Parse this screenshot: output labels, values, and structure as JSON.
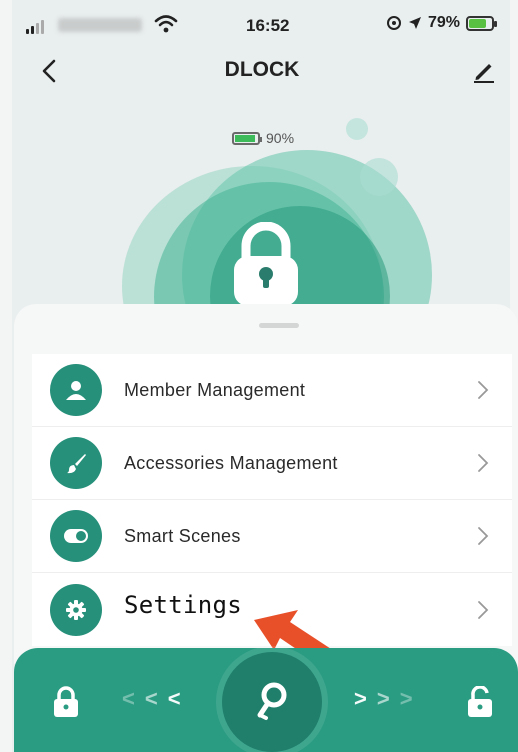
{
  "status_bar": {
    "time": "16:52",
    "battery_percent": "79%",
    "battery_level": 0.79
  },
  "header": {
    "title": "DLOCK",
    "back_icon": "chevron-left-icon",
    "edit_icon": "pencil-icon"
  },
  "lock": {
    "battery_percent": "90%",
    "battery_level": 0.9,
    "icon": "padlock-icon"
  },
  "menu": {
    "items": [
      {
        "label": "Member Management",
        "icon": "person-icon"
      },
      {
        "label": "Accessories Management",
        "icon": "brush-icon"
      },
      {
        "label": "Smart Scenes",
        "icon": "toggle-icon"
      },
      {
        "label": "Settings",
        "icon": "gear-icon"
      }
    ]
  },
  "bottom_bar": {
    "lock_icon": "lock-closed-icon",
    "unlock_icon": "lock-open-icon",
    "key_icon": "key-icon",
    "left_arrows": "< < <",
    "right_arrows": "> > >"
  },
  "colors": {
    "accent": "#2a9c82",
    "accent_dark": "#1f7f6b",
    "icon_bg": "#26907a",
    "highlight_arrow": "#e8502a"
  }
}
